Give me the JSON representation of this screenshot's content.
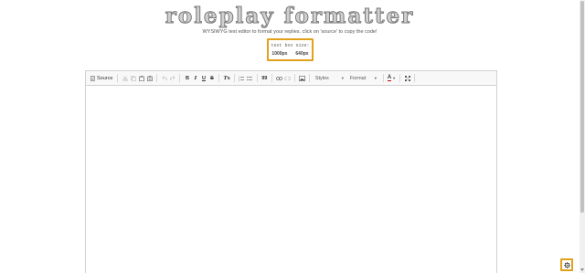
{
  "header": {
    "title": "roleplay formatter",
    "subtitle": "WYSIWYG text editor to format your replies. click on 'source' to copy the code!"
  },
  "text_box_size": {
    "label": "text box size:",
    "options": [
      "1000px",
      "640px"
    ]
  },
  "toolbar": {
    "source_label": "Source",
    "bold_label": "B",
    "italic_label": "I",
    "underline_label": "U",
    "strike_label": "S",
    "removeformat_label": "Tx",
    "blockquote_label": "99",
    "styles_label": "Styles",
    "format_label": "Format",
    "textcolor_label": "A"
  },
  "colors": {
    "accent": "#e2a01c",
    "title_fill": "#d0d0d0",
    "title_outline": "#7a7a7a",
    "toolbar_bg": "#f8f8f8",
    "border": "#d1d1d1"
  },
  "icons": {
    "settings": "gear-icon"
  }
}
